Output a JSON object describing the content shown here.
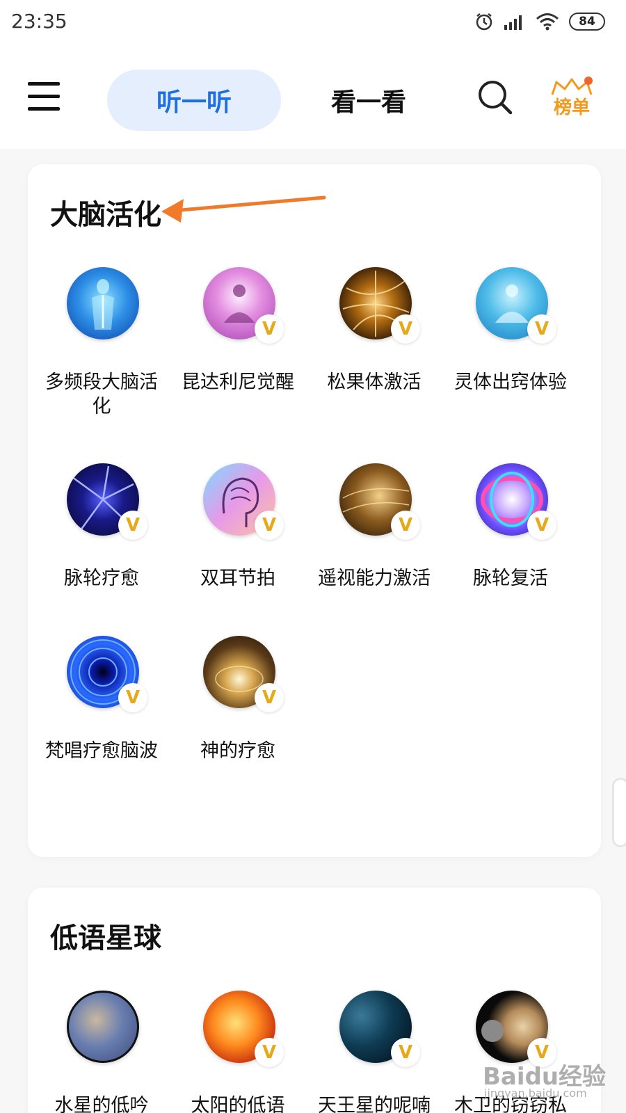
{
  "status_bar": {
    "time": "23:35",
    "battery": "84"
  },
  "header": {
    "tabs": [
      {
        "label": "听一听",
        "active": true
      },
      {
        "label": "看一看",
        "active": false
      }
    ],
    "rank_label": "榜单"
  },
  "sections": [
    {
      "title": "大脑活化",
      "items": [
        {
          "label": "多频段大脑活\n化",
          "vip": false,
          "icon": "body-scan-thumb"
        },
        {
          "label": "昆达利尼觉醒",
          "vip": true,
          "icon": "meditation-pink-thumb"
        },
        {
          "label": "松果体激活",
          "vip": true,
          "icon": "neuron-gold-thumb"
        },
        {
          "label": "灵体出窍体验",
          "vip": true,
          "icon": "meditation-blue-thumb"
        },
        {
          "label": "脉轮疗愈",
          "vip": true,
          "icon": "neuron-blue-thumb"
        },
        {
          "label": "双耳节拍",
          "vip": true,
          "icon": "brain-head-thumb"
        },
        {
          "label": "遥视能力激活",
          "vip": true,
          "icon": "gold-face-thumb"
        },
        {
          "label": "脉轮复活",
          "vip": true,
          "icon": "color-torus-thumb"
        },
        {
          "label": "梵唱疗愈脑波",
          "vip": true,
          "icon": "blue-tunnel-thumb"
        },
        {
          "label": "神的疗愈",
          "vip": true,
          "icon": "light-tunnel-thumb"
        }
      ]
    },
    {
      "title": "低语星球",
      "items": [
        {
          "label": "水星的低吟",
          "vip": false,
          "icon": "mercury-thumb"
        },
        {
          "label": "太阳的低语",
          "vip": true,
          "icon": "sun-thumb"
        },
        {
          "label": "天王星的呢喃",
          "vip": true,
          "icon": "uranus-thumb"
        },
        {
          "label": "木卫的窃窃私",
          "vip": true,
          "icon": "jupiter-thumb"
        }
      ]
    }
  ],
  "vip_badge": "V",
  "watermark": {
    "brand": "Baidu经验",
    "url": "jingyan.baidu.com"
  },
  "colors": {
    "accent": "#1e6fe0",
    "tab_bg": "#e4eefc",
    "rank": "#f29a1e",
    "vip": "#e6a91c",
    "annotation": "#f07a2a"
  }
}
